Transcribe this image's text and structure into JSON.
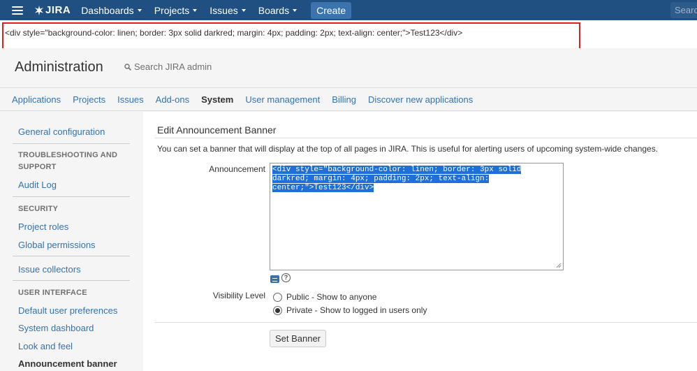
{
  "topbar": {
    "logo_text": "JIRA",
    "nav": [
      "Dashboards",
      "Projects",
      "Issues",
      "Boards"
    ],
    "create_label": "Create",
    "search_placeholder": "Search"
  },
  "announcement": {
    "text": "<div style=\"background-color: linen; border: 3px solid darkred; margin: 4px; padding: 2px; text-align: center;\">Test123</div>",
    "highlight_color": "#e31b1b"
  },
  "admin": {
    "title": "Administration",
    "search_placeholder": "Search JIRA admin"
  },
  "tabs": [
    {
      "label": "Applications",
      "active": false
    },
    {
      "label": "Projects",
      "active": false
    },
    {
      "label": "Issues",
      "active": false
    },
    {
      "label": "Add-ons",
      "active": false
    },
    {
      "label": "System",
      "active": true
    },
    {
      "label": "User management",
      "active": false
    },
    {
      "label": "Billing",
      "active": false
    },
    {
      "label": "Discover new applications",
      "active": false
    }
  ],
  "sidebar": {
    "general_configuration": "General configuration",
    "troubleshooting_heading": "TROUBLESHOOTING AND SUPPORT",
    "audit_log": "Audit Log",
    "security_heading": "SECURITY",
    "project_roles": "Project roles",
    "global_permissions": "Global permissions",
    "issue_collectors": "Issue collectors",
    "user_interface_heading": "USER INTERFACE",
    "default_user_preferences": "Default user preferences",
    "system_dashboard": "System dashboard",
    "look_and_feel": "Look and feel",
    "announcement_banner": "Announcement banner"
  },
  "main": {
    "title": "Edit Announcement Banner",
    "description": "You can set a banner that will display at the top of all pages in JIRA. This is useful for alerting users of upcoming system-wide changes.",
    "announcement_label": "Announcement",
    "announcement_value": "<div style=\"background-color: linen; border: 3px solid darkred; margin: 4px; padding: 2px; text-align: center;\">Test123</div>",
    "visibility_label": "Visibility Level",
    "visibility_options": [
      {
        "label": "Public - Show to anyone",
        "checked": false
      },
      {
        "label": "Private - Show to logged in users only",
        "checked": true
      }
    ],
    "help_glyph": "?",
    "submit_label": "Set Banner"
  },
  "colors": {
    "header_bg": "#205081",
    "create_button": "#3b73af",
    "link": "#3572b0",
    "selection": "#1e6fd9"
  }
}
